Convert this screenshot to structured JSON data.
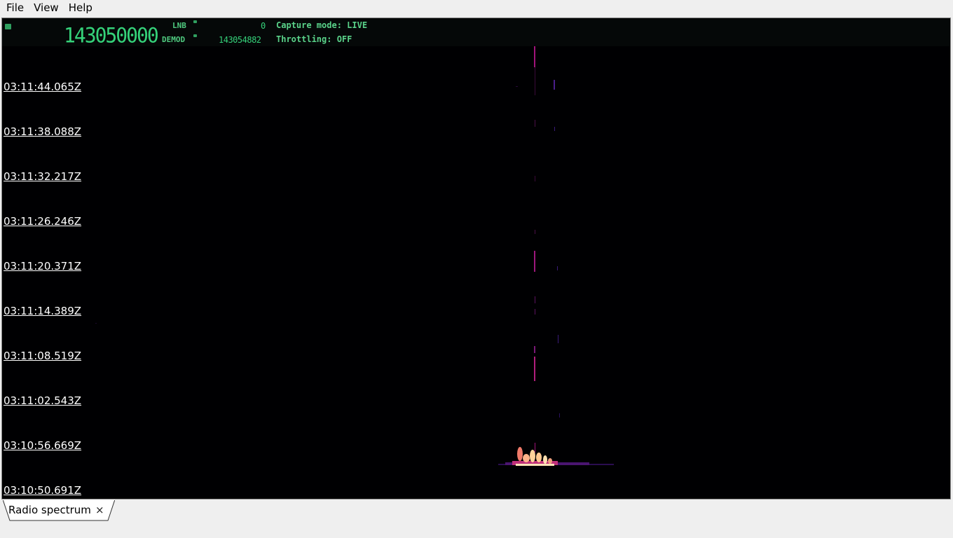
{
  "menu": {
    "file": "File",
    "view": "View",
    "help": "Help"
  },
  "status": {
    "main_freq": "143050000",
    "lnb_label": "LNB",
    "lnb_value": "0",
    "demod_label": "DEMOD",
    "demod_value": "143054882",
    "capture_mode": "Capture mode: LIVE",
    "throttling": "Throttling: OFF"
  },
  "timestamps": [
    "03:11:44.065Z",
    "03:11:38.088Z",
    "03:11:32.217Z",
    "03:11:26.246Z",
    "03:11:20.371Z",
    "03:11:14.389Z",
    "03:11:08.519Z",
    "03:11:02.543Z",
    "03:10:56.669Z",
    "03:10:50.691Z"
  ],
  "tab": {
    "label": "Radio spectrum",
    "close": "×"
  },
  "colors": {
    "lcd": "#35d27a",
    "signal": "#b01e7c",
    "hot": "#ffd29a",
    "background": "#000000"
  }
}
